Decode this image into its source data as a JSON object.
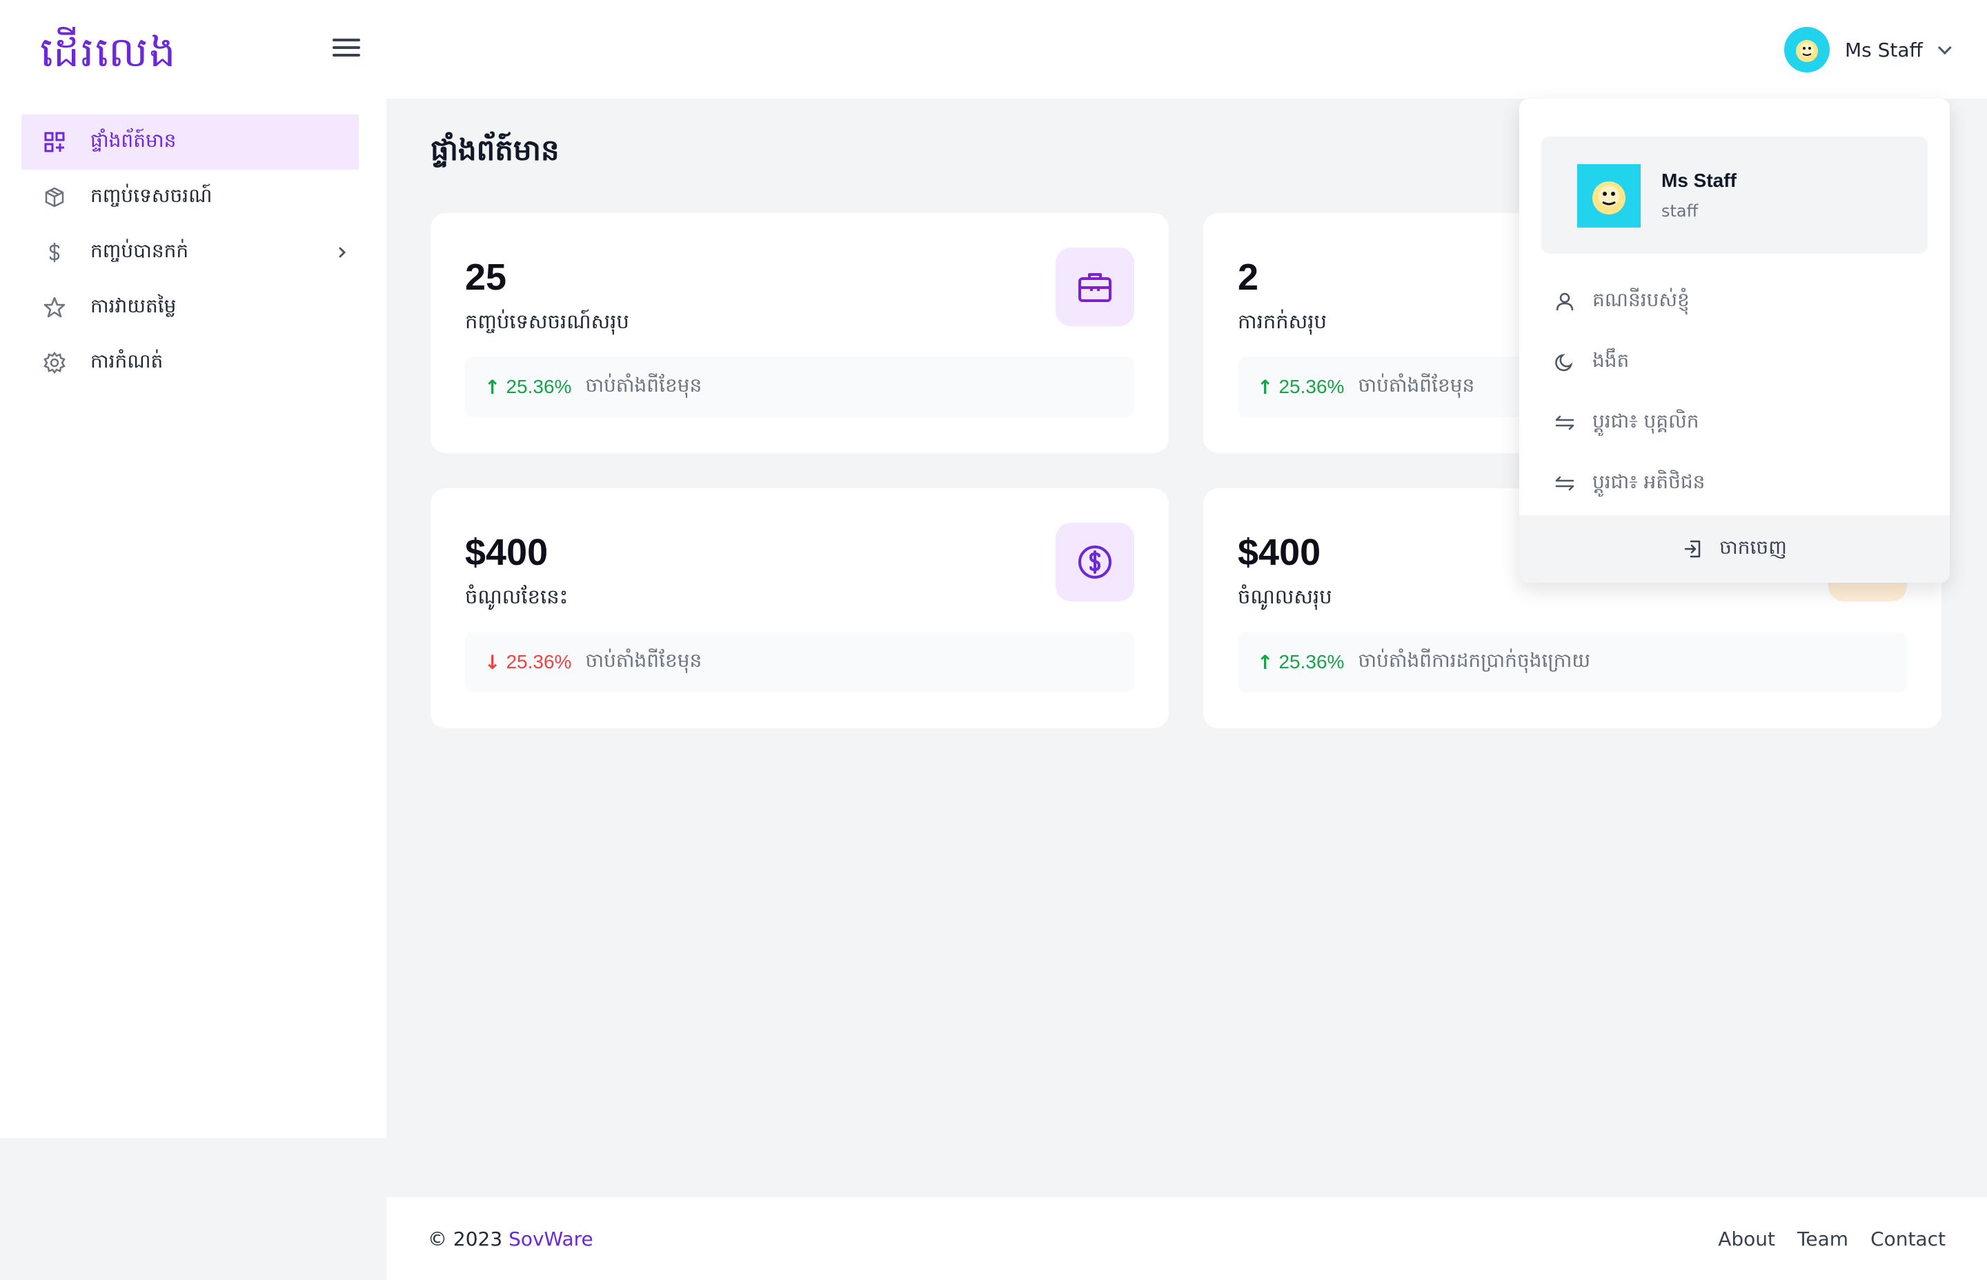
{
  "header": {
    "logo_text": "ដើរលេង",
    "menu_icon": "hamburger-icon",
    "user_name": "Ms Staff",
    "chevron_icon": "chevron-down-icon"
  },
  "sidebar": {
    "items": [
      {
        "label": "ផ្ទាំងព័ត៍មាន",
        "icon": "dashboard-icon",
        "active": true
      },
      {
        "label": "កញ្ចប់ទេសចរណ៍",
        "icon": "package-icon",
        "active": false
      },
      {
        "label": "កញ្ចប់បានកក់",
        "icon": "dollar-icon",
        "active": false,
        "has_submenu": true
      },
      {
        "label": "ការវាយតម្លៃ",
        "icon": "star-icon",
        "active": false
      },
      {
        "label": "ការកំណត់",
        "icon": "gear-icon",
        "active": false
      }
    ]
  },
  "main": {
    "page_title": "ផ្ទាំងព័ត៍មាន",
    "cards": [
      {
        "value": "25",
        "label": "កញ្ចប់ទេសចរណ៍សរុប",
        "trend_direction": "up",
        "trend_arrow": "↑",
        "trend_pct": "25.36%",
        "trend_desc": "ចាប់តាំងពីខែមុន",
        "icon": "briefcase-icon"
      },
      {
        "value": "2",
        "label": "ការកក់សរុប",
        "trend_direction": "up",
        "trend_arrow": "↑",
        "trend_pct": "25.36%",
        "trend_desc": "ចាប់តាំងពីខែមុន",
        "icon": "calendar-icon"
      },
      {
        "value": "$400",
        "label": "ចំណូលខែនេះ",
        "trend_direction": "down",
        "trend_arrow": "↓",
        "trend_pct": "25.36%",
        "trend_desc": "ចាប់តាំងពីខែមុន",
        "icon": "dollar-circle-icon"
      },
      {
        "value": "$400",
        "label": "ចំណូលសរុប",
        "trend_direction": "up",
        "trend_arrow": "↑",
        "trend_pct": "25.36%",
        "trend_desc": "ចាប់តាំងពីការដកប្រាក់ចុងក្រោយ",
        "icon": "wallet-icon"
      }
    ]
  },
  "dropdown": {
    "name": "Ms Staff",
    "role": "staff",
    "items": [
      {
        "label": "គណនីរបស់ខ្ញុំ",
        "icon": "user-icon"
      },
      {
        "label": "ងងឹត",
        "icon": "moon-icon"
      },
      {
        "label": "ប្តូរជា៖ បុគ្គលិក",
        "icon": "switch-icon"
      },
      {
        "label": "ប្តូរជា៖ អតិថិជន",
        "icon": "switch-icon"
      }
    ],
    "logout_label": "ចាកចេញ"
  },
  "footer": {
    "copyright_prefix": "© 2023",
    "brand": "SovWare",
    "links": [
      "About",
      "Team",
      "Contact"
    ]
  },
  "colors": {
    "accent": "#6d28d9",
    "accent_light": "#f3e8ff",
    "up": "#16a34a",
    "down": "#ef4444",
    "avatar_bg": "#22d3ee"
  }
}
